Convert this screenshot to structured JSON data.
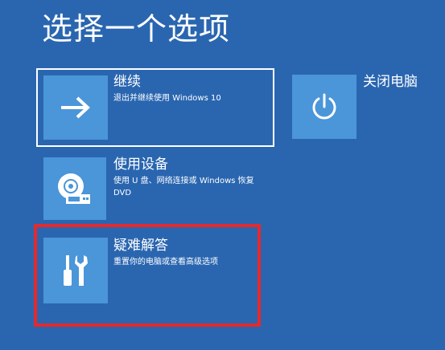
{
  "page": {
    "title": "选择一个选项"
  },
  "options": {
    "continue": {
      "title": "继续",
      "description": "退出并继续使用 Windows 10",
      "icon": "arrow-right-icon"
    },
    "use_device": {
      "title": "使用设备",
      "description": "使用 U 盘、网络连接或 Windows 恢复 DVD",
      "icon": "disc-drive-icon"
    },
    "troubleshoot": {
      "title": "疑难解答",
      "description": "重置你的电脑或查看高级选项",
      "icon": "tools-icon"
    },
    "shutdown": {
      "title": "关闭电脑",
      "icon": "power-icon"
    }
  },
  "colors": {
    "background": "#2a66b0",
    "tile": "#4b95d9",
    "highlight": "#e8282b",
    "text": "#ffffff"
  }
}
